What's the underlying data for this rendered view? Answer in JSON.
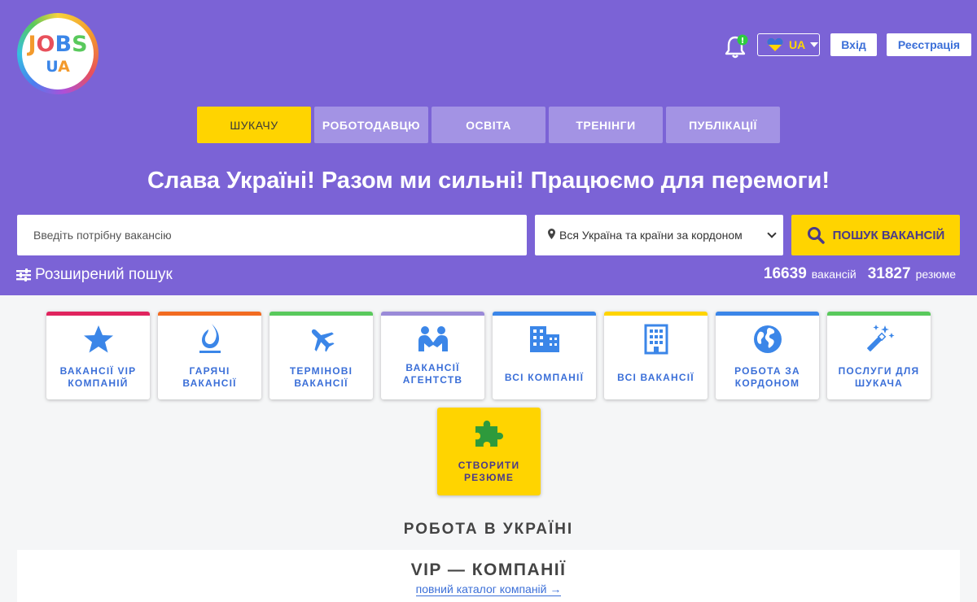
{
  "header": {
    "logo": {
      "top": "JOBS",
      "bottom": "UA"
    },
    "language": {
      "code": "UA",
      "flag_colors": [
        "#3b6fd8",
        "#ffd700"
      ]
    },
    "login_label": "Вхід",
    "register_label": "Реєстрація",
    "notification_badge": "!"
  },
  "nav": {
    "tabs": [
      {
        "label": "ШУКАЧУ",
        "active": true
      },
      {
        "label": "РОБОТОДАВЦЮ",
        "active": false
      },
      {
        "label": "ОСВІТА",
        "active": false
      },
      {
        "label": "ТРЕНІНГИ",
        "active": false
      },
      {
        "label": "ПУБЛІКАЦІЇ",
        "active": false
      }
    ]
  },
  "slogan": "Слава Україні! Разом ми сильні! Працюємо для перемоги!",
  "search": {
    "placeholder": "Введіть потрібну вакансію",
    "region": "Вся Україна та країни за кордоном",
    "button_label": "ПОШУК ВАКАНСІЙ"
  },
  "advanced_search_label": "Розширений пошук",
  "stats": {
    "vacancies_count": "16639",
    "vacancies_label": "вакансій",
    "resumes_count": "31827",
    "resumes_label": "резюме"
  },
  "categories": [
    {
      "line1": "ВАКАНСІЇ VIP",
      "line2": "КОМПАНІЙ",
      "icon": "star-icon",
      "accent": "#e0245e"
    },
    {
      "line1": "ГАРЯЧІ",
      "line2": "ВАКАНСІЇ",
      "icon": "flame-icon",
      "accent": "#f26b21"
    },
    {
      "line1": "ТЕРМІНОВІ",
      "line2": "ВАКАНСІЇ",
      "icon": "plane-icon",
      "accent": "#59c95c"
    },
    {
      "line1": "ВАКАНСІЇ",
      "line2": "АГЕНТСТВ",
      "icon": "handshake-icon",
      "accent": "#9a8ad8"
    },
    {
      "line1": "ВСІ КОМПАНІЇ",
      "line2": "",
      "icon": "buildings-icon",
      "accent": "#3b86e8"
    },
    {
      "line1": "ВСІ ВАКАНСІЇ",
      "line2": "",
      "icon": "office-building-icon",
      "accent": "#ffd400"
    },
    {
      "line1": "РОБОТА ЗА",
      "line2": "КОРДОНОМ",
      "icon": "globe-icon",
      "accent": "#3b86e8"
    },
    {
      "line1": "ПОСЛУГИ ДЛЯ",
      "line2": "ШУКАЧА",
      "icon": "magic-wand-icon",
      "accent": "#59c95c"
    }
  ],
  "create_resume": {
    "line1": "СТВОРИТИ",
    "line2": "РЕЗЮМЕ",
    "icon": "puzzle-icon"
  },
  "section_title": "РОБОТА В УКРАЇНІ",
  "vip_panel": {
    "title": "VIP — КОМПАНІЇ",
    "link": "повний каталог компаній →"
  },
  "colors": {
    "header_bg": "#7b63d6",
    "accent_yellow": "#ffd400",
    "link_blue": "#3b6fd8"
  }
}
